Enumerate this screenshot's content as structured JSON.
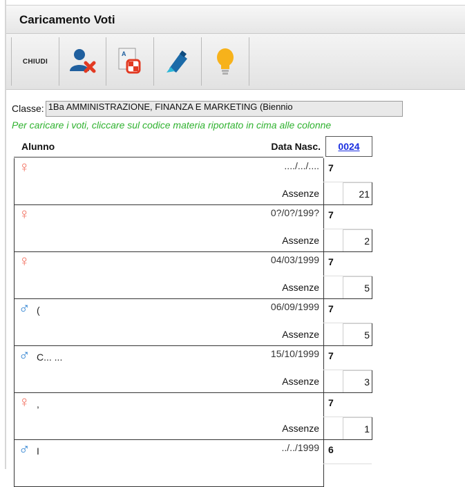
{
  "window": {
    "title": "Caricamento Voti"
  },
  "toolbar": {
    "buttons": [
      {
        "label": "CHIUDI",
        "icon": "close-text-button"
      },
      {
        "icon": "user-remove-icon"
      },
      {
        "icon": "grade-document-icon"
      },
      {
        "icon": "highlighter-icon"
      },
      {
        "icon": "lightbulb-icon"
      }
    ]
  },
  "form": {
    "classe_label": "Classe:",
    "classe_value": "1Ba AMMINISTRAZIONE, FINANZA E MARKETING (Biennio",
    "hint": "Per caricare i voti, cliccare sul codice materia riportato in cima alle colonne"
  },
  "table": {
    "headers": {
      "alunno": "Alunno",
      "data_nascita": "Data Nasc.",
      "subject_code": "0024"
    },
    "assenze_label": "Assenze",
    "rows": [
      {
        "gender": "♀",
        "name": "",
        "dob": "..../.../....",
        "vote": "7",
        "assenze": "21"
      },
      {
        "gender": "♀",
        "name": "",
        "dob": "0?/0?/199?",
        "vote": "7",
        "assenze": "2"
      },
      {
        "gender": "♀",
        "name": "",
        "dob": "04/03/1999",
        "vote": "7",
        "assenze": "5"
      },
      {
        "gender": "♂",
        "name": "(",
        "dob": "06/09/1999",
        "vote": "7",
        "assenze": "5"
      },
      {
        "gender": "♂",
        "name": "C... ...",
        "dob": "15/10/1999",
        "vote": "7",
        "assenze": "3"
      },
      {
        "gender": "♀",
        "name": ",",
        "dob": "",
        "vote": "7",
        "assenze": "1"
      },
      {
        "gender": "♂",
        "name": "I",
        "dob": "../../1999",
        "vote": "6",
        "assenze": ""
      }
    ]
  },
  "colors": {
    "female": "#f26e5e",
    "male": "#2a7fd0",
    "hint": "#2fb22f",
    "link": "#1a2ee0"
  }
}
